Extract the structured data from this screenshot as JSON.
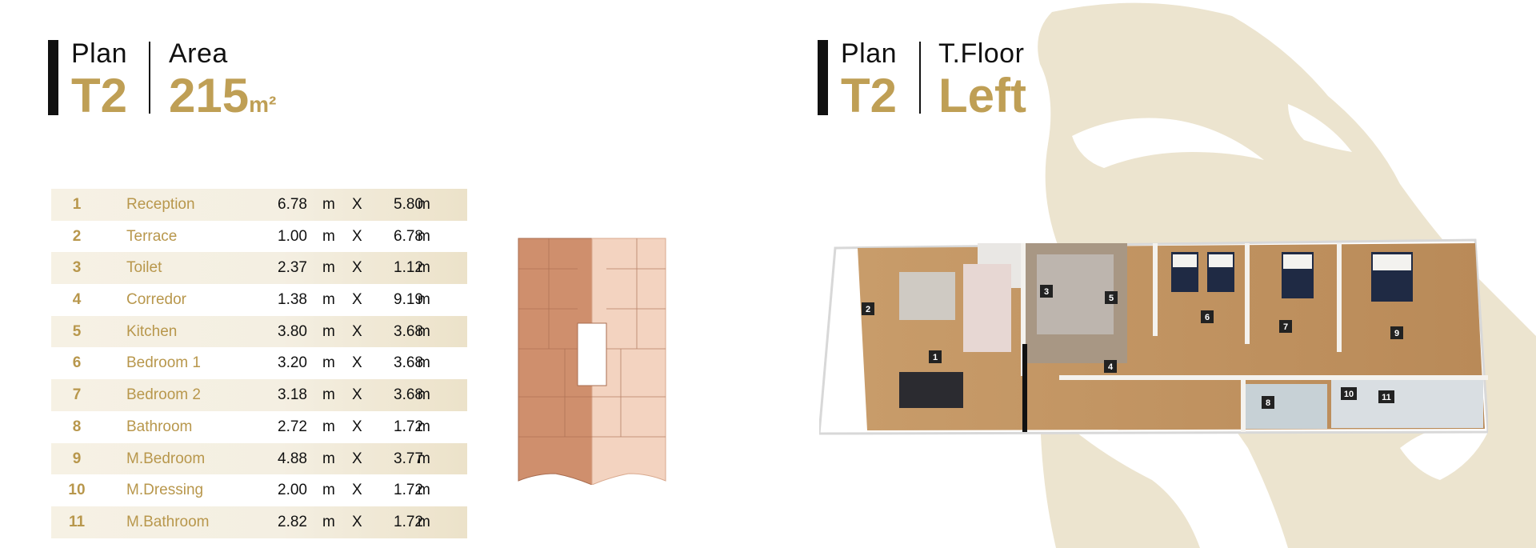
{
  "left_heading": {
    "plan_label": "Plan",
    "plan_value": "T2",
    "area_label": "Area",
    "area_value": "215",
    "area_unit": "m²"
  },
  "right_heading": {
    "plan_label": "Plan",
    "plan_value": "T2",
    "floor_label": "T.Floor",
    "floor_value": "Left"
  },
  "rooms": [
    {
      "num": "1",
      "name": "Reception",
      "w": "6.78",
      "l": "5.80",
      "unit": "m",
      "x": "X"
    },
    {
      "num": "2",
      "name": "Terrace",
      "w": "1.00",
      "l": "6.78",
      "unit": "m",
      "x": "X"
    },
    {
      "num": "3",
      "name": "Toilet",
      "w": "2.37",
      "l": "1.12",
      "unit": "m",
      "x": "X"
    },
    {
      "num": "4",
      "name": "Corredor",
      "w": "1.38",
      "l": "9.19",
      "unit": "m",
      "x": "X"
    },
    {
      "num": "5",
      "name": "Kitchen",
      "w": "3.80",
      "l": "3.68",
      "unit": "m",
      "x": "X"
    },
    {
      "num": "6",
      "name": "Bedroom 1",
      "w": "3.20",
      "l": "3.68",
      "unit": "m",
      "x": "X"
    },
    {
      "num": "7",
      "name": "Bedroom 2",
      "w": "3.18",
      "l": "3.68",
      "unit": "m",
      "x": "X"
    },
    {
      "num": "8",
      "name": "Bathroom",
      "w": "2.72",
      "l": "1.72",
      "unit": "m",
      "x": "X"
    },
    {
      "num": "9",
      "name": "M.Bedroom",
      "w": "4.88",
      "l": "3.77",
      "unit": "m",
      "x": "X"
    },
    {
      "num": "10",
      "name": "M.Dressing",
      "w": "2.00",
      "l": "1.72",
      "unit": "m",
      "x": "X"
    },
    {
      "num": "11",
      "name": "M.Bathroom",
      "w": "2.82",
      "l": "1.72",
      "unit": "m",
      "x": "X"
    }
  ],
  "plan_markers": [
    "1",
    "2",
    "3",
    "4",
    "5",
    "6",
    "7",
    "8",
    "9",
    "10",
    "11"
  ],
  "colors": {
    "gold": "#bf9f55",
    "row_shade": "#f4efe2",
    "watermark": "#ece4cf",
    "keyplan_dark": "#cf8f6d",
    "keyplan_light": "#f3d3c0"
  }
}
